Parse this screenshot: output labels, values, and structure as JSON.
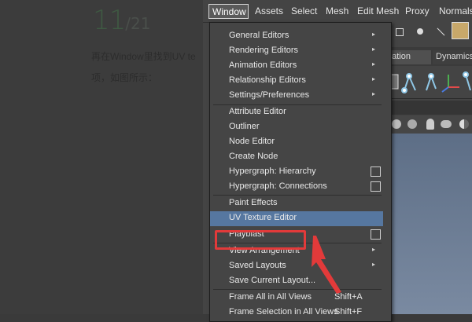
{
  "tutorial": {
    "step_current": "11",
    "step_total": "/21",
    "line1": "再在Window里找到UV te",
    "line2": "项，如图所示："
  },
  "menubar": [
    "Window",
    "Assets",
    "Select",
    "Mesh",
    "Edit Mesh",
    "Proxy",
    "Normals"
  ],
  "tabs": {
    "tab1": "nation",
    "tab2": "Dynamics"
  },
  "menu": {
    "items": [
      {
        "label": "General Editors",
        "suffix": "arrow"
      },
      {
        "label": "Rendering Editors",
        "suffix": "arrow"
      },
      {
        "label": "Animation Editors",
        "suffix": "arrow"
      },
      {
        "label": "Relationship Editors",
        "suffix": "arrow"
      },
      {
        "label": "Settings/Preferences",
        "suffix": "arrow"
      },
      {
        "label": "Attribute Editor",
        "suffix": ""
      },
      {
        "label": "Outliner",
        "suffix": ""
      },
      {
        "label": "Node Editor",
        "suffix": ""
      },
      {
        "label": "Create Node",
        "suffix": ""
      },
      {
        "label": "Hypergraph: Hierarchy",
        "suffix": "box"
      },
      {
        "label": "Hypergraph: Connections",
        "suffix": "box"
      },
      {
        "label": "Paint Effects",
        "suffix": ""
      },
      {
        "label": "UV Texture Editor",
        "suffix": "",
        "highlighted": true
      },
      {
        "label": "Playblast",
        "suffix": "box"
      },
      {
        "label": "View Arrangement",
        "suffix": "arrow"
      },
      {
        "label": "Saved Layouts",
        "suffix": "arrow"
      },
      {
        "label": "Save Current Layout...",
        "suffix": ""
      },
      {
        "label": "Frame All in All Views",
        "shortcut": "Shift+A"
      },
      {
        "label": "Frame Selection in All Views",
        "shortcut": "Shift+F"
      }
    ]
  },
  "icons": {
    "submenu": "arrow-right-icon",
    "option_box": "option-box-icon"
  },
  "colors": {
    "highlight": "#5677a0",
    "callout": "#e23a3a",
    "step_number": "#3f5a43"
  }
}
